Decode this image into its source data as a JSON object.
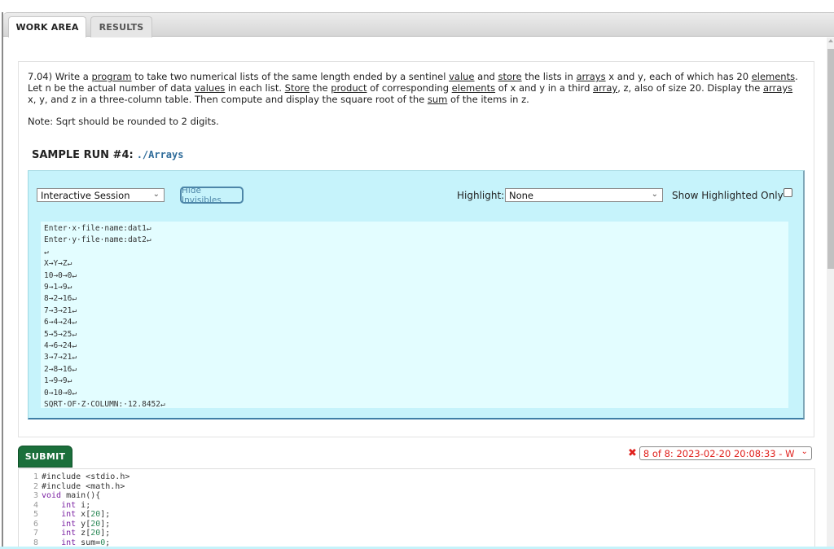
{
  "tabs": [
    {
      "label": "WORK AREA",
      "active": true
    },
    {
      "label": "RESULTS",
      "active": false
    }
  ],
  "problem": {
    "segments": [
      {
        "t": "7.04) Write a "
      },
      {
        "t": "program",
        "u": true
      },
      {
        "t": " to take two numerical lists of the same length ended by a sentinel "
      },
      {
        "t": "value",
        "u": true
      },
      {
        "t": " and "
      },
      {
        "t": "store",
        "u": true
      },
      {
        "t": " the lists in "
      },
      {
        "t": "arrays",
        "u": true
      },
      {
        "t": " x and y, each of which has 20 "
      },
      {
        "t": "elements",
        "u": true
      },
      {
        "t": ". Let n be the actual number of data "
      },
      {
        "t": "values",
        "u": true
      },
      {
        "t": " in each list. "
      },
      {
        "t": "Store",
        "u": true
      },
      {
        "t": " the "
      },
      {
        "t": "product",
        "u": true
      },
      {
        "t": " of corresponding "
      },
      {
        "t": "elements",
        "u": true
      },
      {
        "t": " of x and y in a third "
      },
      {
        "t": "array",
        "u": true
      },
      {
        "t": ", z, also of size 20. Display the "
      },
      {
        "t": "arrays",
        "u": true
      },
      {
        "t": " x, y, and z in a three-column table. Then compute and display the square root of the "
      },
      {
        "t": "sum",
        "u": true
      },
      {
        "t": " of the items in z."
      }
    ],
    "note": "Note: Sqrt should be rounded to 2 digits."
  },
  "sample_run": {
    "title": "SAMPLE RUN #4:",
    "command": "./Arrays"
  },
  "session": {
    "mode_select": "Interactive Session",
    "hide_invisibles_label": "Hide Invisibles",
    "highlight_label": "Highlight:",
    "highlight_select": "None",
    "show_highlighted_label": "Show Highlighted Only",
    "show_highlighted_checked": false,
    "output_lines": [
      "Enter·x·file·name:dat1↵",
      "Enter·y·file·name:dat2↵",
      "↵",
      "X→Y→Z↵",
      "10→0→0↵",
      "9→1→9↵",
      "8→2→16↵",
      "7→3→21↵",
      "6→4→24↵",
      "5→5→25↵",
      "4→6→24↵",
      "3→7→21↵",
      "2→8→16↵",
      "1→9→9↵",
      "0→10→0↵",
      "SQRT·OF·Z·COLUMN:·12.8452↵"
    ]
  },
  "submit_label": "SUBMIT",
  "submission": {
    "status_icon": "x-icon",
    "status_color": "#e0201c",
    "selected": "8 of 8: 2023-02-20 20:08:33 - W"
  },
  "editor": {
    "line_numbers": [
      "1",
      "2",
      "3",
      "4",
      "5",
      "6",
      "7",
      "8"
    ],
    "lines": [
      [
        {
          "t": "#include <stdio.h>"
        }
      ],
      [
        {
          "t": "#include <math.h>"
        }
      ],
      [
        {
          "t": "void",
          "c": "kw"
        },
        {
          "t": " main(){"
        }
      ],
      [
        {
          "t": "    "
        },
        {
          "t": "int",
          "c": "kw"
        },
        {
          "t": " i;"
        }
      ],
      [
        {
          "t": "    "
        },
        {
          "t": "int",
          "c": "kw"
        },
        {
          "t": " x["
        },
        {
          "t": "20",
          "c": "num"
        },
        {
          "t": "];"
        }
      ],
      [
        {
          "t": "    "
        },
        {
          "t": "int",
          "c": "kw"
        },
        {
          "t": " y["
        },
        {
          "t": "20",
          "c": "num"
        },
        {
          "t": "];"
        }
      ],
      [
        {
          "t": "    "
        },
        {
          "t": "int",
          "c": "kw"
        },
        {
          "t": " z["
        },
        {
          "t": "20",
          "c": "num"
        },
        {
          "t": "];"
        }
      ],
      [
        {
          "t": "    "
        },
        {
          "t": "int",
          "c": "kw"
        },
        {
          "t": " sum="
        },
        {
          "t": "0",
          "c": "num"
        },
        {
          "t": ";"
        }
      ]
    ]
  },
  "colors": {
    "submit_green": "#1b6f3b",
    "session_bg": "#c6f3fb",
    "output_bg": "#e3fdff",
    "command_blue": "#2f6c9a"
  }
}
